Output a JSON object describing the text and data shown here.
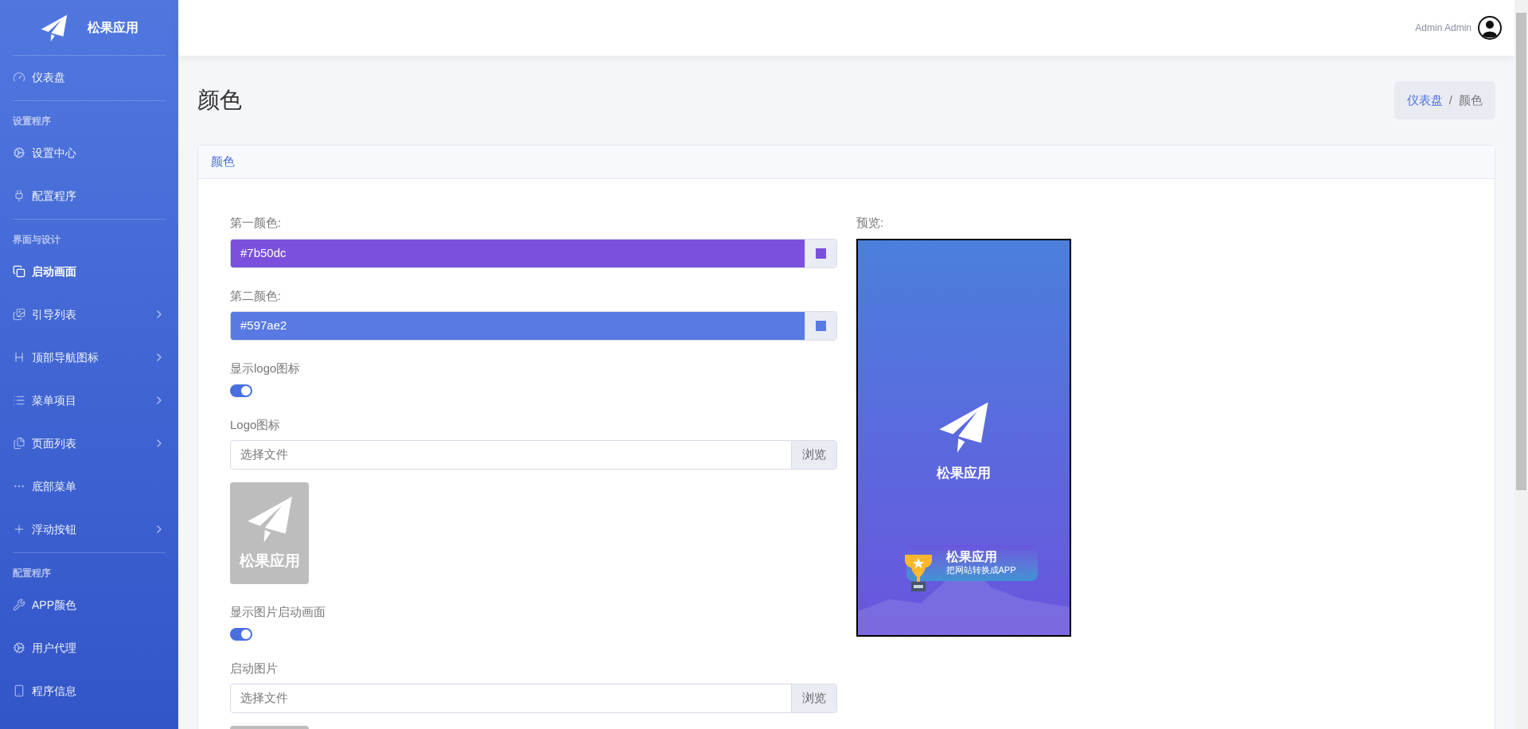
{
  "brand": {
    "name": "松果应用"
  },
  "sidebar": {
    "groups": [
      {
        "items": [
          {
            "label": "仪表盘",
            "selected": false,
            "expandable": false
          }
        ]
      },
      {
        "heading": "设置程序",
        "items": [
          {
            "label": "设置中心",
            "selected": false,
            "expandable": false
          },
          {
            "label": "配置程序",
            "selected": false,
            "expandable": false
          }
        ]
      },
      {
        "heading": "界面与设计",
        "items": [
          {
            "label": "启动画面",
            "selected": true,
            "expandable": false
          },
          {
            "label": "引导列表",
            "selected": false,
            "expandable": true
          },
          {
            "label": "顶部导航图标",
            "selected": false,
            "expandable": true
          },
          {
            "label": "菜单项目",
            "selected": false,
            "expandable": true
          },
          {
            "label": "页面列表",
            "selected": false,
            "expandable": true
          },
          {
            "label": "底部菜单",
            "selected": false,
            "expandable": false
          },
          {
            "label": "浮动按钮",
            "selected": false,
            "expandable": true
          }
        ]
      },
      {
        "heading": "配置程序",
        "items": [
          {
            "label": "APP颜色",
            "selected": false,
            "expandable": false
          },
          {
            "label": "用户代理",
            "selected": false,
            "expandable": false
          },
          {
            "label": "程序信息",
            "selected": false,
            "expandable": false
          }
        ]
      }
    ]
  },
  "header": {
    "user": "Admin Admin"
  },
  "page": {
    "title": "颜色",
    "breadcrumb": [
      {
        "label": "仪表盘",
        "link": true
      },
      {
        "label": "/",
        "link": false
      },
      {
        "label": "颜色",
        "link": false
      }
    ]
  },
  "card": {
    "title": "颜色",
    "fields": [
      {
        "kind": "color",
        "label": "第一颜色:",
        "value": "#7b50dc"
      },
      {
        "kind": "color",
        "label": "第二颜色:",
        "value": "#597ae2"
      },
      {
        "kind": "toggle",
        "label": "显示logo图标",
        "on": true
      },
      {
        "kind": "file",
        "label": "Logo图标",
        "placeholder": "选择文件",
        "button": "浏览"
      },
      {
        "kind": "logo",
        "caption": "松果应用"
      },
      {
        "kind": "toggle",
        "label": "显示图片启动画面",
        "on": true
      },
      {
        "kind": "file",
        "label": "启动图片",
        "placeholder": "选择文件",
        "button": "浏览"
      },
      {
        "kind": "image"
      }
    ],
    "preview": {
      "label": "预览:",
      "app_name": "松果应用",
      "banner_title": "松果应用",
      "banner_subtitle": "把网站转换成APP"
    }
  }
}
